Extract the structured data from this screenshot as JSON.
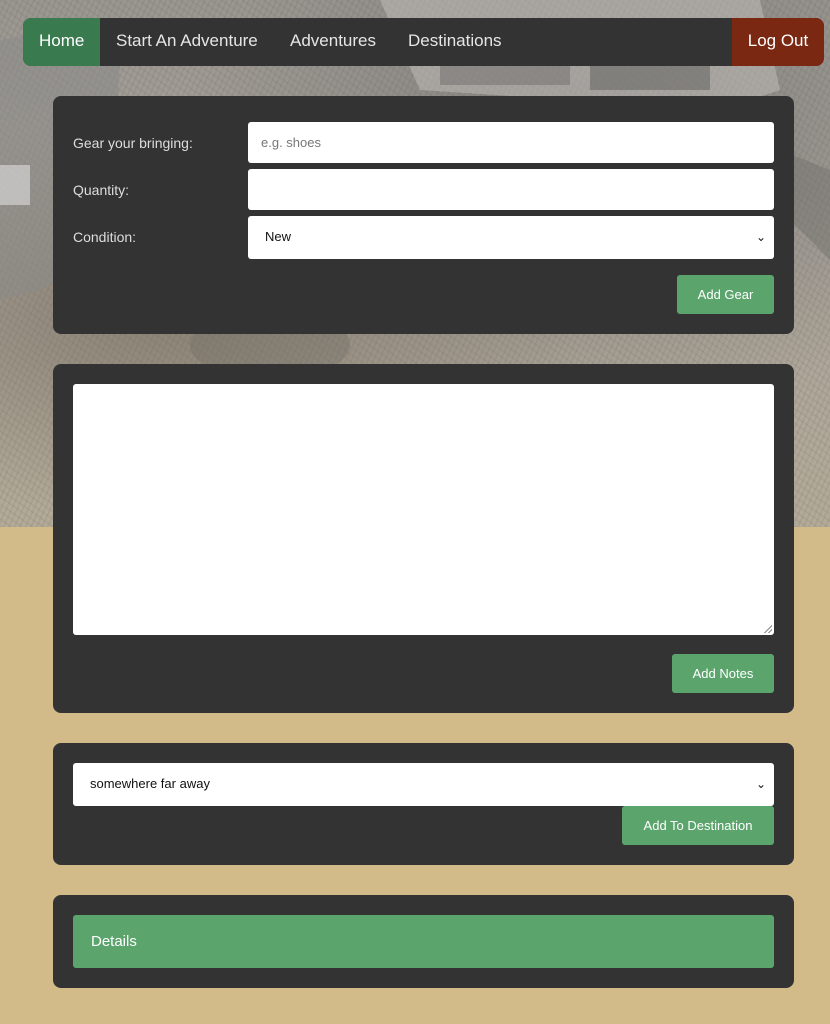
{
  "nav": {
    "home": "Home",
    "start_adventure": "Start An Adventure",
    "adventures": "Adventures",
    "destinations": "Destinations",
    "logout": "Log Out"
  },
  "gear_form": {
    "gear_label": "Gear your bringing:",
    "gear_placeholder": "e.g. shoes",
    "gear_value": "",
    "quantity_label": "Quantity:",
    "quantity_value": "",
    "condition_label": "Condition:",
    "condition_selected": "New",
    "submit_label": "Add Gear"
  },
  "notes_form": {
    "notes_value": "",
    "submit_label": "Add Notes"
  },
  "destination_form": {
    "selected_destination": "somewhere far away",
    "submit_label": "Add To Destination"
  },
  "details": {
    "title": "Details"
  },
  "colors": {
    "panel": "#333333",
    "accent_green": "#5ba56d",
    "home_green": "#3a7a4f",
    "logout_red": "#7b2813",
    "page_tan": "#d2bb88"
  }
}
